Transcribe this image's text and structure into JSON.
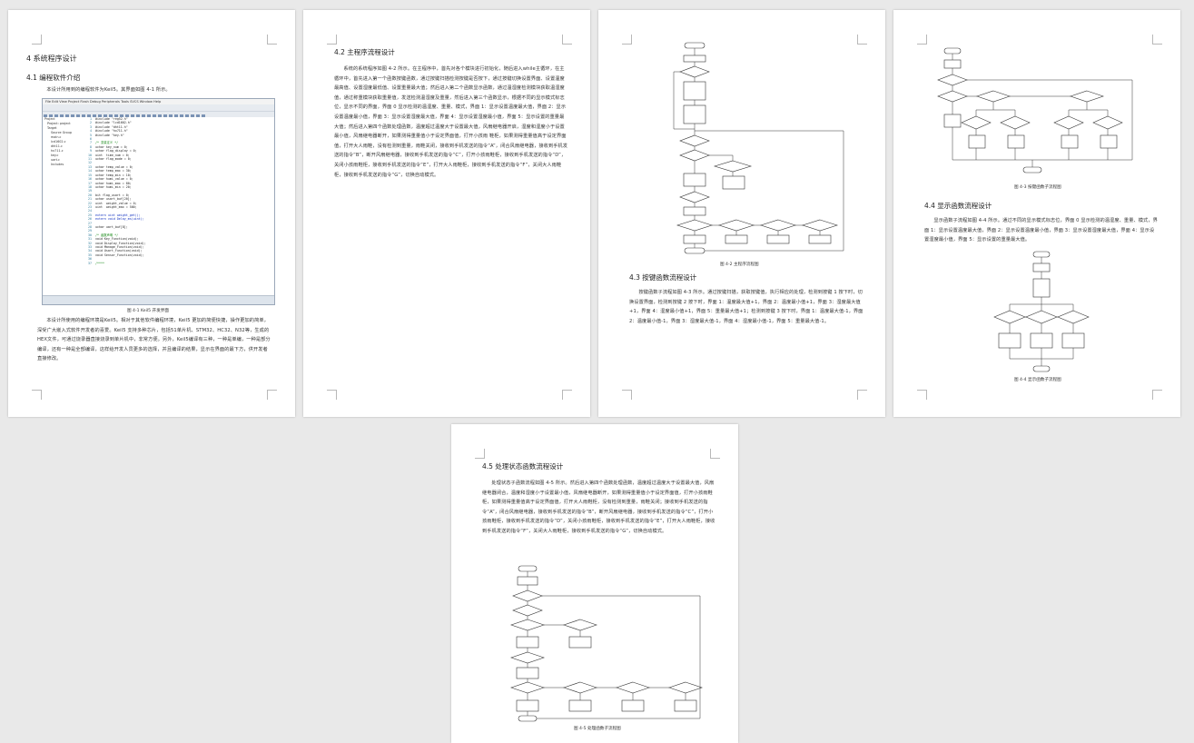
{
  "pages": {
    "p1": {
      "h1": "4 系统程序设计",
      "h2": "4.1 编程软件介绍",
      "p_intro": "本设计所用到的编程软件为Keil5。其界面如图 4-1 所示。",
      "caption": "图 4-1 Keil5 开发界面",
      "p_body": "本设计所使用的编程环境是Keil5。相对于其他软件编程环境，Keil5 更加的简便快捷，操作更加的简单，深受广大嵌入式软件开发者的喜爱。Keil5 支持多种芯片，包括51单片机、STM32、HC32、N32等，生成的HEX文件，可通过烧录器直接烧录到单片机中，非常方便。另外，Keil5编译有三种，一种是单编，一种是部分编译，还有一种是全部编译，这样给开发人员更多的选择，并且编译的结果，显示在界面的最下方，供开发者直接修改。"
    },
    "p2": {
      "h2": "4.2 主程序流程设计",
      "p_body": "系统的系统程序如图 4-2 所示。在主程序中，首先对各个模块进行初始化，随后进入while主循环，在主循环中，首先进入第一个函数按键函数，通过按键扫描检测按键是否按下，通过按键切换设置界面、设置温度最高值、设置湿度最低值、设置重量最大值；然后进入第二个函数显示函数，通过温湿度检测模块获取温湿度值，通过称重模块获取重量值，发送检测温湿度及重量，然后进入第三个函数显示，根据不同的显示模式标志位，显示不同的界面，界面 0 显示检测的温湿度、重量、模式，界面 1：显示设置温度最大值，界面 2：显示设置温度最小值，界面 3：显示设置湿度最大值，界面 4：显示设置湿度最小值，界面 5：显示设置的重量最大值；然后进入第四个函数处理函数，温度超过温度大于设置最大值，风扇继电器开启，湿度和湿度小于设置最小值，风扇继电器断开，如果测得重量值小于设定界面值，打开小孩雨 鞋柜，如果测得重量值高于设定界面值，打开大人雨鞋，没有检测到重量，雨鞋关闭，接收到手机发送的指令“A”，闭合风扇继电器，接收到手机发送的指令“B”，断开风扇继电器，接收到手机发送的指令“C”，打开小孩雨鞋柜，接收到手机发送的指令“D”，关闭小孩雨鞋柜，接收到手机发送的指令“E”，打开大人雨鞋柜，接收到手机发送的指令“F”，关闭大人雨鞋柜，接收到手机发送的指令“G”，切换自动模式。"
    },
    "p3": {
      "caption": "图 4-2 主程序流程图",
      "h2": "4.3 按键函数流程设计",
      "p_body": "按键函数子流程如图 4-3 所示。通过按键扫描，获取按键值，执行相应的处理，检测到按键 1 按下时，切换设置界面，检测到按键 2 按下时，界面 1：温度最大值+1，界面 2：温度最小值+1，界面 3：湿度最大值+1，界面 4：湿度最小值+1，界面 5：重量最大值+1；检测到按键 3 按下时，界面 1：温度最大值-1，界面 2：温度最小值-1，界面 3：湿度最大值-1，界面 4：湿度最小值-1，界面 5：重量最大值-1。"
    },
    "p4": {
      "caption1": "图 4-3 按键函数子流程图",
      "h2": "4.4 显示函数流程设计",
      "p_body": "显示函数子流程如图 4-4 所示。通过不同的显示模式标志位，界面 0 显示检测的温湿度、重量、模式，界面 1：显示设置温度最大值，界面 2：显示设置温度最小值，界面 3：显示设置湿度最大值，界面 4：显示设置湿度最小值，界面 5：显示设置的重量最大值。",
      "caption2": "图 4-4 显示函数子流程图"
    },
    "p5": {
      "h2": "4.5 处理状态函数流程设计",
      "p_body": "处理状态子函数流程如图 4-5 所示。然后进入第四个函数处理函数，温度超过温度大于设置最大值，风扇继电器闭合，温度和湿度小于设置最小值，风扇继电器断开，如果测得重量值小于设定界面值，打开小孩雨鞋柜，如果测得重量值高于设定界面值，打开大人雨鞋柜，没有检测到重量，雨鞋关闭；接收到手机发送的指令“A”，闭合风扇继电器，接收到手机发送的指令“B”，断开风扇继电器，接收到手机发送的指令“C”，打开小孩雨鞋柜，接收到手机发送的指令“D”，关闭小孩雨鞋柜，接收到手机发送的指令“E”，打开大人雨鞋柜，接收到手机发送的指令“F”，关闭大人雨鞋柜，接收到手机发送的指令“G”，切换自动模式。",
      "caption": "图 4-5 处理函数子流程图"
    }
  },
  "ide": {
    "menu": "File  Edit  View  Project  Flash  Debug  Peripherals  Tools  SVCS  Window  Help",
    "tree": [
      "Project",
      "Project: project",
      "Target",
      "Source Group",
      "main.c",
      "lcd1602.c",
      "dht11.c",
      "hx711.c",
      "key.c",
      "uart.c",
      "Includes"
    ],
    "code": [
      [
        "1",
        "#include \"reg52.h\"",
        ""
      ],
      [
        "2",
        "#include \"lcd1602.h\"",
        ""
      ],
      [
        "3",
        "#include \"dht11.h\"",
        ""
      ],
      [
        "4",
        "#include \"hx711.h\"",
        ""
      ],
      [
        "5",
        "#include \"key.h\"",
        ""
      ],
      [
        "6",
        "",
        ""
      ],
      [
        "7",
        "/* 变量定义 */",
        "c"
      ],
      [
        "8",
        "uchar key_num = 0;",
        ""
      ],
      [
        "9",
        "uchar flag_display = 0;",
        ""
      ],
      [
        "10",
        "uint  time_num = 0;",
        ""
      ],
      [
        "11",
        "uchar flag_mode = 0;",
        ""
      ],
      [
        "12",
        "",
        ""
      ],
      [
        "13",
        "uchar temp_value = 0;",
        ""
      ],
      [
        "14",
        "uchar temp_max = 30;",
        ""
      ],
      [
        "15",
        "uchar temp_min = 10;",
        ""
      ],
      [
        "16",
        "uchar humi_value = 0;",
        ""
      ],
      [
        "17",
        "uchar humi_max = 80;",
        ""
      ],
      [
        "18",
        "uchar humi_min = 20;",
        ""
      ],
      [
        "19",
        "",
        ""
      ],
      [
        "20",
        "bit flag_usart = 0;",
        ""
      ],
      [
        "21",
        "uchar usart_buf[20];",
        ""
      ],
      [
        "22",
        "uint  weight_value = 0;",
        ""
      ],
      [
        "23",
        "uint  weight_max = 500;",
        ""
      ],
      [
        "24",
        "",
        ""
      ],
      [
        "25",
        "extern uint weight_get();",
        "k"
      ],
      [
        "26",
        "extern void Delay_ms(uint);",
        "k"
      ],
      [
        "27",
        "",
        ""
      ],
      [
        "28",
        "uchar uart_buf[8];",
        ""
      ],
      [
        "29",
        "",
        ""
      ],
      [
        "30",
        "/* 函数声明 */",
        "c"
      ],
      [
        "31",
        "void Key_Function(void);",
        ""
      ],
      [
        "32",
        "void Display_Function(void);",
        ""
      ],
      [
        "33",
        "void Manage_Function(void);",
        ""
      ],
      [
        "34",
        "void Usart_Function(void);",
        ""
      ],
      [
        "35",
        "void Sensor_Function(void);",
        ""
      ],
      [
        "36",
        "",
        ""
      ],
      [
        "37",
        "/****",
        "c"
      ]
    ]
  }
}
